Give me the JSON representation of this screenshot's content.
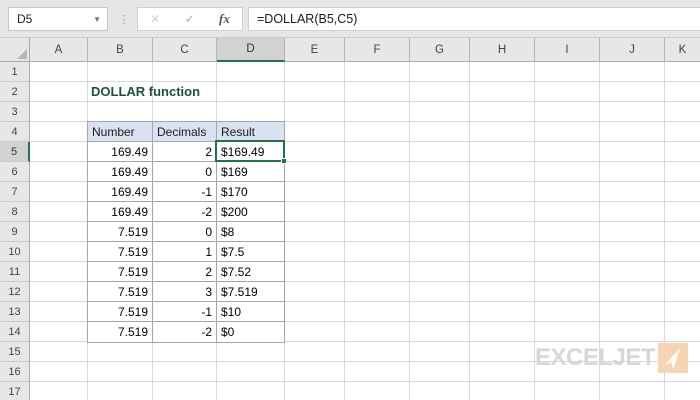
{
  "formula_bar": {
    "name_box_value": "D5",
    "cancel_icon": "✕",
    "enter_icon": "✓",
    "fx_label": "fx",
    "formula": "=DOLLAR(B5,C5)"
  },
  "grid": {
    "columns": [
      "A",
      "B",
      "C",
      "D",
      "E",
      "F",
      "G",
      "H",
      "I",
      "J",
      "K"
    ],
    "visible_rows": 17,
    "selected_cell": "D5",
    "selected_column": "D",
    "selected_row": 5
  },
  "sheet_title": "DOLLAR function",
  "table": {
    "start_cell": "B4",
    "headers": [
      "Number",
      "Decimals",
      "Result"
    ],
    "rows": [
      [
        "169.49",
        "2",
        "$169.49"
      ],
      [
        "169.49",
        "0",
        "$169"
      ],
      [
        "169.49",
        "-1",
        "$170"
      ],
      [
        "169.49",
        "-2",
        "$200"
      ],
      [
        "7.519",
        "0",
        "$8"
      ],
      [
        "7.519",
        "1",
        "$7.5"
      ],
      [
        "7.519",
        "2",
        "$7.52"
      ],
      [
        "7.519",
        "3",
        "$7.519"
      ],
      [
        "7.519",
        "-1",
        "$10"
      ],
      [
        "7.519",
        "-2",
        "$0"
      ]
    ]
  },
  "logo": {
    "text": "EXCELJET"
  },
  "colors": {
    "accent_green": "#217346",
    "table_header_fill": "#D9E1F2",
    "title_green": "#1E4F3E",
    "logo_gray": "#D7D7D7",
    "logo_orange": "#F8D3B4",
    "chrome_gray": "#E6E6E6"
  }
}
